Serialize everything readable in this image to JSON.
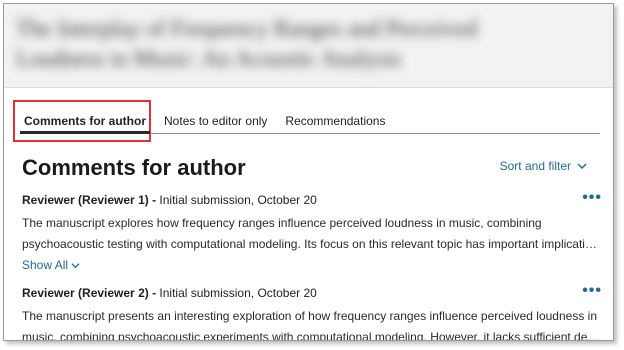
{
  "header": {
    "blurred_title": "The Interplay of Frequency Ranges and Perceived Loudness in Music: An Acoustic Analysis"
  },
  "tabs": [
    {
      "label": "Comments for author",
      "active": true
    },
    {
      "label": "Notes to editor only",
      "active": false
    },
    {
      "label": "Recommendations",
      "active": false
    }
  ],
  "main": {
    "title": "Comments for author",
    "sort_filter_label": "Sort and filter"
  },
  "reviews": [
    {
      "reviewer": "Reviewer (Reviewer 1)",
      "separator": " - ",
      "meta": "Initial submission, October 20",
      "line1": "The manuscript explores how frequency ranges influence perceived loudness in music, combining",
      "line2": "psychoacoustic testing with computational modeling. Its focus on this relevant topic has important implications for",
      "show_all_label": "Show All"
    },
    {
      "reviewer": "Reviewer (Reviewer 2)",
      "separator": " - ",
      "meta": "Initial submission, October 20",
      "line1": "The manuscript presents an interesting exploration of how frequency ranges influence perceived loudness in",
      "line2": "music, combining psychoacoustic experiments with computational modeling. However, it lacks sufficient detail in"
    }
  ],
  "colors": {
    "link": "#246b8f",
    "highlight": "#e03232",
    "header_bg": "#f2f2f2"
  },
  "icons": {
    "more": "more-options-icon",
    "chevron": "chevron-down-icon"
  }
}
